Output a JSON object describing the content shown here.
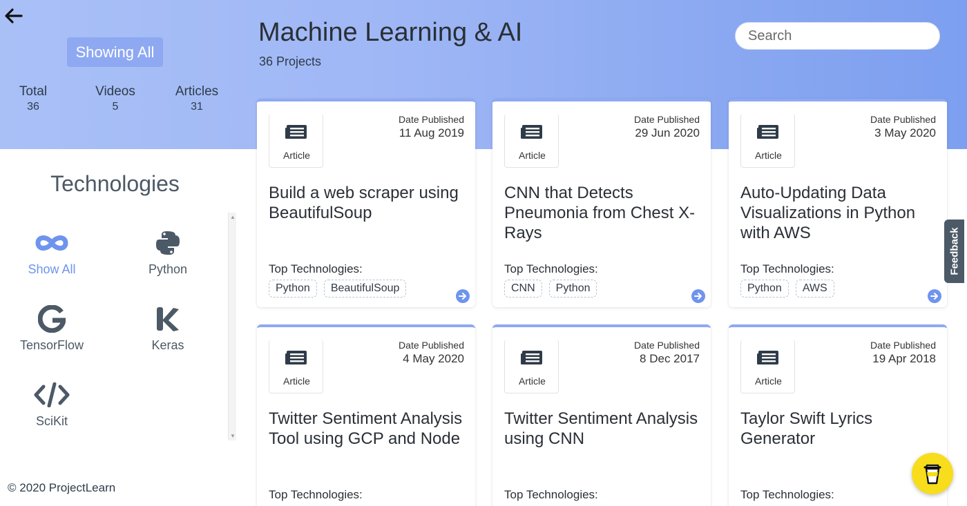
{
  "left_panel": {
    "filter_button": "Showing All",
    "stats": [
      {
        "label": "Total",
        "value": "36"
      },
      {
        "label": "Videos",
        "value": "5"
      },
      {
        "label": "Articles",
        "value": "31"
      }
    ],
    "technologies_title": "Technologies",
    "technologies": [
      {
        "label": "Show All",
        "icon": "infinity-icon",
        "active": true
      },
      {
        "label": "Python",
        "icon": "python-icon"
      },
      {
        "label": "TensorFlow",
        "icon": "tensorflow-icon"
      },
      {
        "label": "Keras",
        "icon": "keras-icon"
      },
      {
        "label": "SciKit",
        "icon": "code-icon"
      }
    ],
    "copyright": "© 2020 ProjectLearn"
  },
  "header": {
    "title": "Machine Learning & AI",
    "count": "36 Projects",
    "search_placeholder": "Search"
  },
  "cards": [
    {
      "type": "Article",
      "date_label": "Date Published",
      "date": "11 Aug 2019",
      "title": "Build a web scraper using BeautifulSoup",
      "tech_label": "Top Technologies:",
      "tags": [
        "Python",
        "BeautifulSoup"
      ]
    },
    {
      "type": "Article",
      "date_label": "Date Published",
      "date": "29 Jun 2020",
      "title": "CNN that Detects Pneumonia from Chest X-Rays",
      "tech_label": "Top Technologies:",
      "tags": [
        "CNN",
        "Python"
      ]
    },
    {
      "type": "Article",
      "date_label": "Date Published",
      "date": "3 May 2020",
      "title": "Auto-Updating Data Visualizations in Python with AWS",
      "tech_label": "Top Technologies:",
      "tags": [
        "Python",
        "AWS"
      ]
    },
    {
      "type": "Article",
      "date_label": "Date Published",
      "date": "4 May 2020",
      "title": "Twitter Sentiment Analysis Tool using GCP and Node",
      "tech_label": "Top Technologies:",
      "tags": []
    },
    {
      "type": "Article",
      "date_label": "Date Published",
      "date": "8 Dec 2017",
      "title": "Twitter Sentiment Analysis using CNN",
      "tech_label": "Top Technologies:",
      "tags": []
    },
    {
      "type": "Article",
      "date_label": "Date Published",
      "date": "19 Apr 2018",
      "title": "Taylor Swift Lyrics Generator",
      "tech_label": "Top Technologies:",
      "tags": []
    }
  ],
  "feedback_label": "Feedback",
  "colors": {
    "accent": "#6e94ee",
    "band": "#9fb7f5",
    "coffee": "#f7dd1b"
  }
}
